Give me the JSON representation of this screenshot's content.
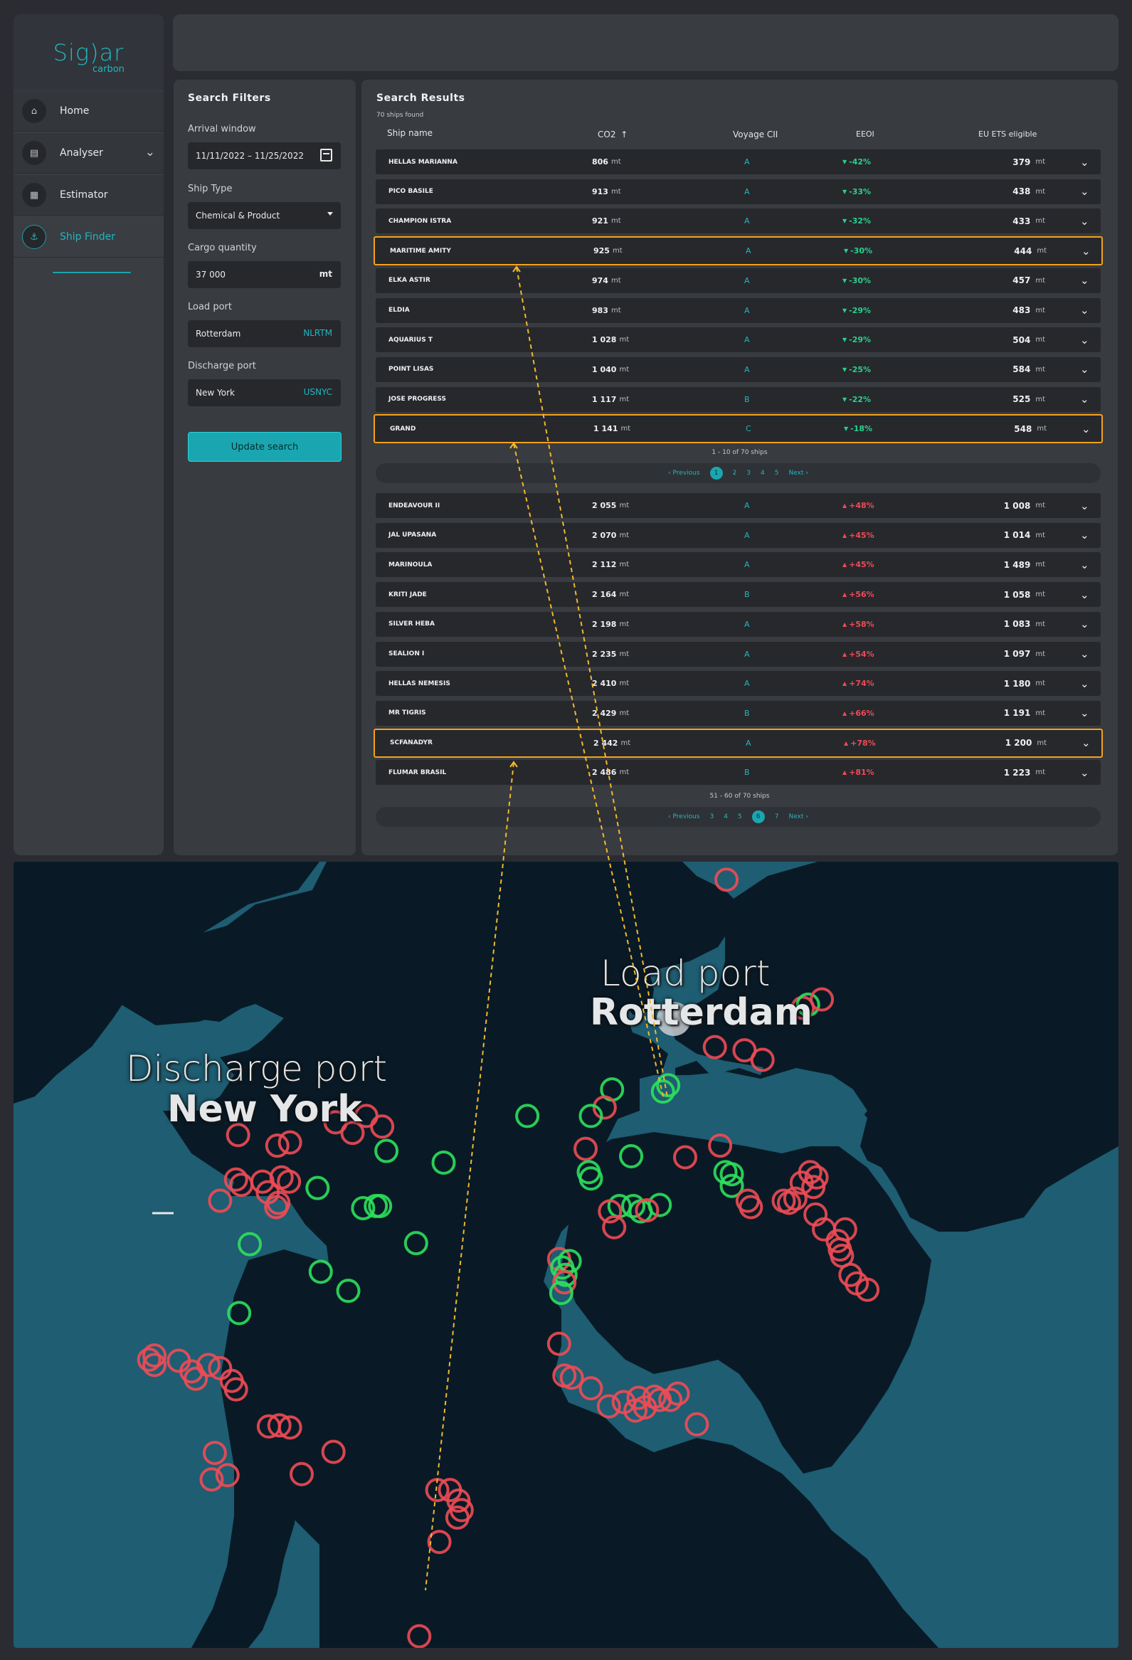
{
  "brand": {
    "name": "Sig)ar",
    "sub": "carbon"
  },
  "nav": [
    {
      "label": "Home",
      "icon": "home-icon",
      "glyph": "⌂"
    },
    {
      "label": "Analyser",
      "icon": "analyser-icon",
      "glyph": "▤"
    },
    {
      "label": "Estimator",
      "icon": "estimator-icon",
      "glyph": "▦"
    },
    {
      "label": "Ship Finder",
      "icon": "ship-icon",
      "glyph": "⚓"
    }
  ],
  "filters": {
    "title": "Search Filters",
    "arrival_label": "Arrival window",
    "arrival_value": "11/11/2022 – 11/25/2022",
    "ship_type_label": "Ship Type",
    "ship_type_value": "Chemical & Product",
    "cargo_label": "Cargo quantity",
    "cargo_value": "37 000",
    "cargo_unit": "mt",
    "load_label": "Load port",
    "load_value": "Rotterdam",
    "load_code": "NLRTM",
    "discharge_label": "Discharge port",
    "discharge_value": "New York",
    "discharge_code": "USNYC",
    "button": "Update search"
  },
  "results": {
    "title": "Search Results",
    "count": "70 ships found",
    "headers": {
      "name": "Ship name",
      "co2": "CO2",
      "sort_icon": "sort-asc-icon",
      "cii": "Voyage CII",
      "eeoi": "EEOI",
      "ets": "EU ETS eligible"
    },
    "unit": "mt",
    "page1": [
      {
        "name": "HELLAS MARIANNA",
        "co2": "806",
        "cii": "A",
        "eeoi": "-42%",
        "dir": "down",
        "ets": "379"
      },
      {
        "name": "PICO BASILE",
        "co2": "913",
        "cii": "A",
        "eeoi": "-33%",
        "dir": "down",
        "ets": "438"
      },
      {
        "name": "CHAMPION ISTRA",
        "co2": "921",
        "cii": "A",
        "eeoi": "-32%",
        "dir": "down",
        "ets": "433"
      },
      {
        "name": "MARITIME AMITY",
        "co2": "925",
        "cii": "A",
        "eeoi": "-30%",
        "dir": "down",
        "ets": "444"
      },
      {
        "name": "ELKA ASTIR",
        "co2": "974",
        "cii": "A",
        "eeoi": "-30%",
        "dir": "down",
        "ets": "457"
      },
      {
        "name": "ELDIA",
        "co2": "983",
        "cii": "A",
        "eeoi": "-29%",
        "dir": "down",
        "ets": "483"
      },
      {
        "name": "AQUARIUS T",
        "co2": "1 028",
        "cii": "A",
        "eeoi": "-29%",
        "dir": "down",
        "ets": "504"
      },
      {
        "name": "POINT LISAS",
        "co2": "1 040",
        "cii": "A",
        "eeoi": "-25%",
        "dir": "down",
        "ets": "584"
      },
      {
        "name": "JOSE PROGRESS",
        "co2": "1 117",
        "cii": "B",
        "eeoi": "-22%",
        "dir": "down",
        "ets": "525"
      },
      {
        "name": "GRAND",
        "co2": "1 141",
        "cii": "C",
        "eeoi": "-18%",
        "dir": "down",
        "ets": "548"
      }
    ],
    "page1_range": "1 - 10 of 70 ships",
    "pager1": {
      "prev": "Previous",
      "pages": [
        "1",
        "2",
        "3",
        "4",
        "5"
      ],
      "current": "1",
      "next": "Next"
    },
    "page6": [
      {
        "name": "ENDEAVOUR II",
        "co2": "2 055",
        "cii": "A",
        "eeoi": "+48%",
        "dir": "up",
        "ets": "1 008"
      },
      {
        "name": "JAL UPASANA",
        "co2": "2 070",
        "cii": "A",
        "eeoi": "+45%",
        "dir": "up",
        "ets": "1 014"
      },
      {
        "name": "MARINOULA",
        "co2": "2 112",
        "cii": "A",
        "eeoi": "+45%",
        "dir": "up",
        "ets": "1 489"
      },
      {
        "name": "KRITI JADE",
        "co2": "2 164",
        "cii": "B",
        "eeoi": "+56%",
        "dir": "up",
        "ets": "1 058"
      },
      {
        "name": "SILVER HEBA",
        "co2": "2 198",
        "cii": "A",
        "eeoi": "+58%",
        "dir": "up",
        "ets": "1 083"
      },
      {
        "name": "SEALION I",
        "co2": "2 235",
        "cii": "A",
        "eeoi": "+54%",
        "dir": "up",
        "ets": "1 097"
      },
      {
        "name": "HELLAS NEMESIS",
        "co2": "2 410",
        "cii": "A",
        "eeoi": "+74%",
        "dir": "up",
        "ets": "1 180"
      },
      {
        "name": "MR TIGRIS",
        "co2": "2 429",
        "cii": "B",
        "eeoi": "+66%",
        "dir": "up",
        "ets": "1 191"
      },
      {
        "name": "SCFANADYR",
        "co2": "2 442",
        "cii": "A",
        "eeoi": "+78%",
        "dir": "up",
        "ets": "1 200"
      },
      {
        "name": "FLUMAR BRASIL",
        "co2": "2 486",
        "cii": "B",
        "eeoi": "+81%",
        "dir": "up",
        "ets": "1 223"
      }
    ],
    "page6_range": "51 - 60 of 70 ships",
    "pager6": {
      "prev": "Previous",
      "pages": [
        "3",
        "4",
        "5",
        "6",
        "7"
      ],
      "current": "6",
      "next": "Next"
    },
    "highlighted_ships": [
      "MARITIME AMITY",
      "GRAND",
      "SCFANADYR"
    ]
  },
  "map": {
    "load_label": "Load port",
    "load_port": "Rotterdam",
    "discharge_label": "Discharge port",
    "discharge_port": "New York",
    "colors": {
      "ocean": "#1e5d72",
      "land": "#091a26",
      "good": "#2ee05c",
      "bad": "#ee4b55",
      "highlight": "#f5b82a"
    }
  }
}
